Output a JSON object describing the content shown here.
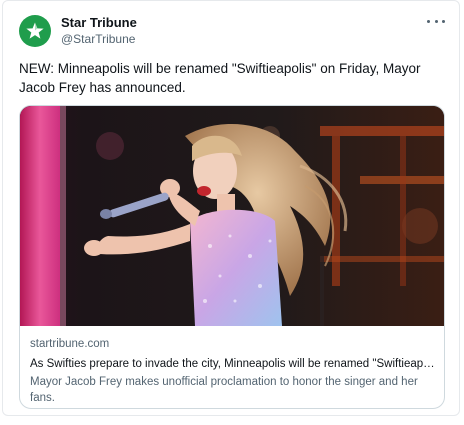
{
  "author": {
    "display_name": "Star Tribune",
    "handle": "@StarTribune",
    "avatar_icon": "star-logo-icon",
    "avatar_color": "#1f9d4c"
  },
  "more_menu_icon": "more-horizontal-icon",
  "tweet": {
    "text": "NEW: Minneapolis will be renamed \"Swiftieapolis\" on Friday, Mayor Jacob Frey has announced."
  },
  "link_card": {
    "image_icon": "performer-photo",
    "domain": "startribune.com",
    "title": "As Swifties prepare to invade the city, Minneapolis will be renamed \"Swiftieapolis\" on Friday",
    "description": "Mayor Jacob Frey makes unofficial proclamation to honor the singer and her fans."
  }
}
